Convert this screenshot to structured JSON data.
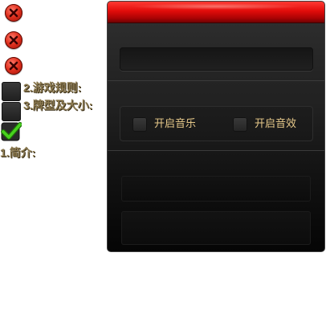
{
  "sprites": {
    "close_icons": [
      "close-1",
      "close-2",
      "close-3"
    ],
    "label_rules": "2.游戏规则:",
    "label_cards": "3.牌型及大小:",
    "label_intro": "1.简介:"
  },
  "panel": {
    "options": {
      "music_label": "开启音乐",
      "effect_label": "开启音效",
      "music_checked": false,
      "effect_checked": false
    }
  },
  "colors": {
    "header_red": "#e10c0a",
    "panel_dark": "#222222",
    "label_gold": "#e7c98a",
    "sprite_label": "#8c7a50",
    "tick_green": "#3ec21a"
  },
  "icons": {
    "close": "close-x-icon",
    "tick": "checkmark-icon"
  }
}
